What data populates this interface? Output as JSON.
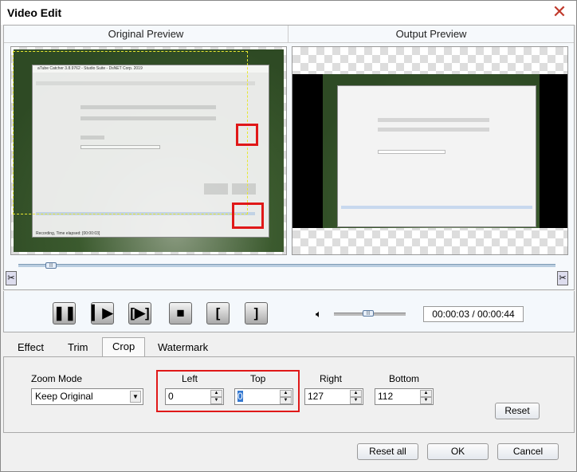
{
  "window": {
    "title": "Video Edit",
    "close_icon": "close-x-icon"
  },
  "preview": {
    "original_label": "Original Preview",
    "output_label": "Output Preview",
    "frame_title": "aTube Catcher 3.8.9762 - Studio Suite - DsNET Corp. 2019",
    "frame_status": "Recording, Time elapsed: [00:00:03]"
  },
  "playback": {
    "buttons": [
      "pause",
      "play",
      "play-segment",
      "stop",
      "mark-in",
      "mark-out"
    ],
    "timeline_position": 0.068,
    "volume_level": 0.5,
    "time": "00:00:03 / 00:00:44"
  },
  "tabs": [
    {
      "label": "Effect"
    },
    {
      "label": "Trim"
    },
    {
      "label": "Crop",
      "active": true
    },
    {
      "label": "Watermark"
    }
  ],
  "crop": {
    "zoom_mode_label": "Zoom Mode",
    "zoom_mode_value": "Keep Original",
    "left_label": "Left",
    "left_value": "0",
    "top_label": "Top",
    "top_value": "0",
    "right_label": "Right",
    "right_value": "127",
    "bottom_label": "Bottom",
    "bottom_value": "112",
    "reset_label": "Reset"
  },
  "footer": {
    "reset_all_label": "Reset all",
    "ok_label": "OK",
    "cancel_label": "Cancel"
  },
  "colors": {
    "highlight": "#e01818",
    "crop_guide": "#e8e830"
  }
}
